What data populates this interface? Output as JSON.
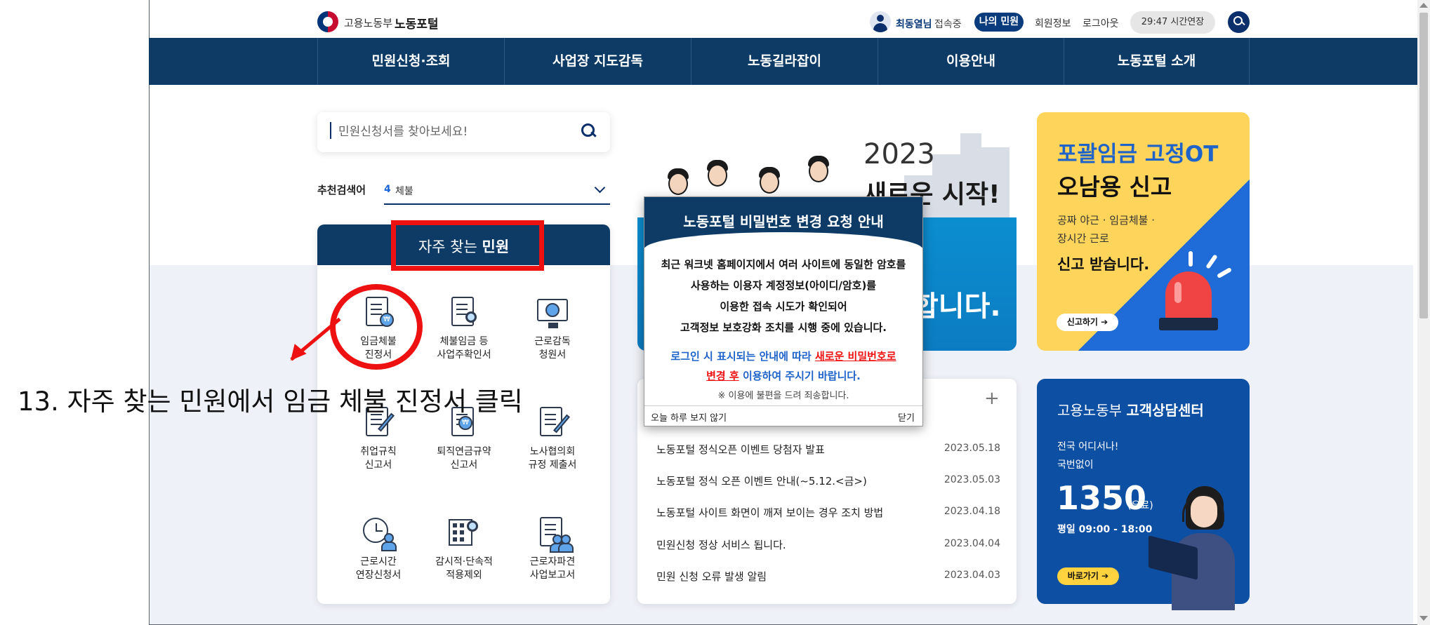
{
  "header": {
    "ministry": "고용노동부",
    "portal": "노동포털",
    "user_name": "최동열님",
    "user_status": "접속중",
    "my_button": "나의 민원",
    "member_info": "회원정보",
    "logout": "로그아웃",
    "session_timer": "29:47 시간연장"
  },
  "nav": {
    "items": [
      "민원신청·조회",
      "사업장 지도감독",
      "노동길라잡이",
      "이용안내",
      "노동포털 소개"
    ]
  },
  "search": {
    "placeholder": "민원신청서를 찾아보세요!",
    "rec_label": "추천검색어",
    "rec_number": "4",
    "rec_word": "체불"
  },
  "frequent": {
    "title_prefix": "자주 찾는",
    "title_strong": "민원",
    "items": [
      {
        "label": "임금체불\n진정서",
        "icon": "wage-doc-icon"
      },
      {
        "label": "체불임금 등\n사업주확인서",
        "icon": "doc-search-icon"
      },
      {
        "label": "근로감독\n청원서",
        "icon": "monitor-icon"
      },
      {
        "label": "취업규칙\n신고서",
        "icon": "checklist-doc-icon"
      },
      {
        "label": "퇴직연금규약\n신고서",
        "icon": "pension-doc-icon"
      },
      {
        "label": "노사협의회\n규정 제출서",
        "icon": "pen-doc-icon"
      },
      {
        "label": "근로시간\n연장신청서",
        "icon": "clock-person-icon"
      },
      {
        "label": "감시적·단속적\n적용제외",
        "icon": "building-search-icon"
      },
      {
        "label": "근로자파견\n사업보고서",
        "icon": "doc-people-icon"
      }
    ]
  },
  "annotation": {
    "text": "13. 자주 찾는 민원에서 임금 체불 진정서 클릭"
  },
  "banner": {
    "year": "2023",
    "slogan": "새로운 시작!",
    "tail": "합니다."
  },
  "popup": {
    "title": "노동포털 비밀번호 변경 요청 안내",
    "line1": "최근 워크넷 홈페이지에서 여러 사이트에 동일한 암호를",
    "line2": "사용하는 이용자 계정정보(아이디/암호)를",
    "line3": "이용한 접속 시도가  확인되어",
    "line4": "고객정보 보호강화 조치를 시행 중에 있습니다.",
    "notice_a": "로그인 시 표시되는 안내에 따라 ",
    "notice_red1": "새로운 비밀번호로",
    "notice_red2": "변경 후",
    "notice_b": " 이용하여 주시기 바랍니다.",
    "apology": "※ 이용에 불편을 드려 죄송합니다.",
    "no_more_today": "오늘 하루 보지 않기",
    "close": "닫기"
  },
  "notices": {
    "items": [
      {
        "title": "노동포털 정식오픈 이벤트 당첨자 발표",
        "date": "2023.05.18"
      },
      {
        "title": "노동포털 정식 오픈 이벤트 안내(~5.12.<금>)",
        "date": "2023.05.03"
      },
      {
        "title": "노동포털 사이트 화면이 깨져 보이는 경우 조치 방법",
        "date": "2023.04.18"
      },
      {
        "title": "민원신청 정상 서비스 됩니다.",
        "date": "2023.04.04"
      },
      {
        "title": "민원 신청 오류 발생 알림",
        "date": "2023.04.03"
      }
    ]
  },
  "ot_banner": {
    "title1": "포괄임금 고정OT",
    "title2": "오남용 신고",
    "sub": "공짜 야근 · 임금체불 ·\n장시간 근로",
    "cta": "신고 받습니다.",
    "button": "신고하기 ➔"
  },
  "call_center": {
    "title_prefix": "고용노동부",
    "title_strong": "고객상담센터",
    "sub1": "전국 어디서나!",
    "sub2": "국번없이",
    "number": "1350",
    "paid": "(유료)",
    "hours": "평일 09:00 - 18:00",
    "button": "바로가기 ➔"
  },
  "colors": {
    "navy": "#0d3b66",
    "accent_blue": "#1e63c9",
    "annotation_red": "#ee1111",
    "ot_yellow": "#ffd45a"
  }
}
